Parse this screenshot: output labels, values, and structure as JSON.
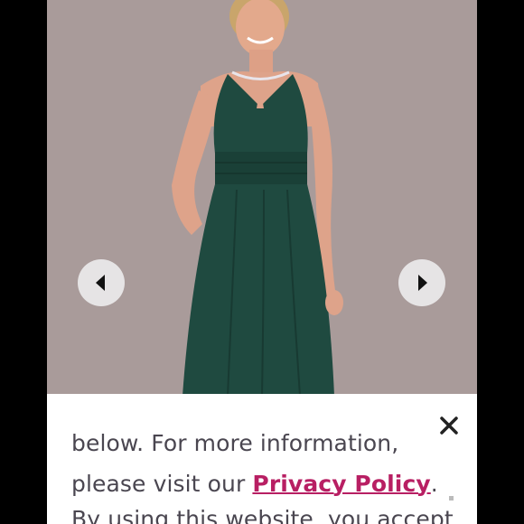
{
  "product": {
    "image_alt": "",
    "prev_icon": "chevron-left-icon",
    "next_icon": "chevron-right-icon",
    "dress_color": "#1f4a40",
    "background_color": "#a99b9a"
  },
  "cookie_banner": {
    "line1": "below. For more information,",
    "line2_prefix": "please visit our ",
    "privacy_link": "Privacy Policy",
    "line2_suffix": ".",
    "line3": "By using this website, you accept",
    "close_icon": "close-icon",
    "link_color": "#b81f63"
  }
}
